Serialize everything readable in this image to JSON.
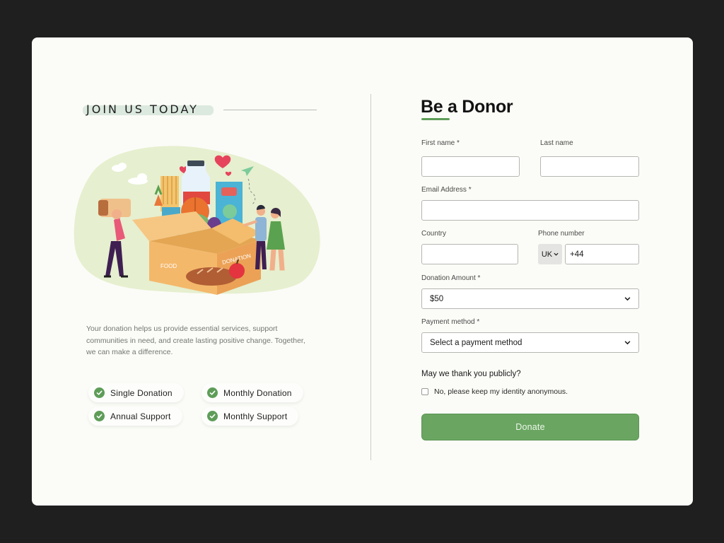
{
  "left": {
    "heading": "JOIN US TODAY",
    "illustration": {
      "box_label_1": "FOOD",
      "box_label_2": "DONATION"
    },
    "description": "Your donation helps us provide essential services, support communities in need, and create lasting positive change. Together, we can make a difference.",
    "options": [
      {
        "label": "Single Donation"
      },
      {
        "label": "Monthly Donation"
      },
      {
        "label": "Annual Support"
      },
      {
        "label": "Monthly Support"
      }
    ]
  },
  "form": {
    "title": "Be a Donor",
    "first_name_label": "First name *",
    "first_name_value": "",
    "last_name_label": "Last name",
    "last_name_value": "",
    "email_label": "Email Address *",
    "email_value": "",
    "country_label": "Country",
    "country_value": "",
    "phone_label": "Phone number",
    "phone_country": "UK",
    "phone_value": "+44",
    "amount_label": "Donation Amount *",
    "amount_value": "$50",
    "payment_label": "Payment method *",
    "payment_value": "Select a payment method",
    "thank_question": "May we thank you publicly?",
    "anonymous_label": "No, please keep my identity anonymous.",
    "anonymous_checked": false,
    "submit_label": "Donate"
  },
  "colors": {
    "page_bg": "#1f1f1f",
    "card_bg": "#fbfcf7",
    "accent": "#6aa661",
    "check": "#5e9d58"
  }
}
